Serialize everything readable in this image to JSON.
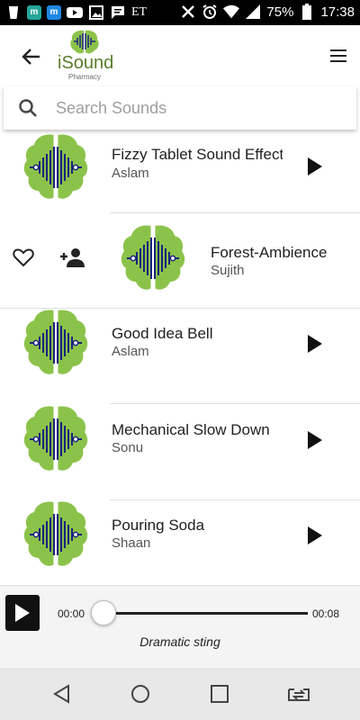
{
  "status_bar": {
    "carrier_text": "ET",
    "battery": "75%",
    "time": "17:38",
    "app_badges": [
      "m",
      "m"
    ]
  },
  "app": {
    "logo_name": "iSound",
    "logo_sub": "Pharmacy",
    "brand_green": "#8bc34a",
    "brand_blue": "#1a237e"
  },
  "search": {
    "placeholder": "Search Sounds",
    "value": ""
  },
  "sounds": [
    {
      "title": "Fizzy Tablet Sound Effect",
      "author": "Aslam",
      "icon": "brain-waveform-icon"
    },
    {
      "title": "Forest-Ambience",
      "author": "Sujith",
      "icon": "brain-waveform-icon",
      "swiped": true,
      "actions": [
        "favorite-icon",
        "add-person-icon"
      ]
    },
    {
      "title": "Good Idea Bell",
      "author": "Aslam",
      "icon": "brain-waveform-icon"
    },
    {
      "title": "Mechanical Slow Down",
      "author": "Sonu",
      "icon": "brain-waveform-icon"
    },
    {
      "title": "Pouring Soda",
      "author": "Shaan",
      "icon": "brain-waveform-icon"
    }
  ],
  "player": {
    "current_time": "00:00",
    "total_time": "00:08",
    "progress": 0,
    "now_playing": "Dramatic sting"
  },
  "nav_bar": {
    "buttons": [
      "back-triangle-icon",
      "home-circle-icon",
      "recents-square-icon",
      "screen-share-icon"
    ]
  }
}
